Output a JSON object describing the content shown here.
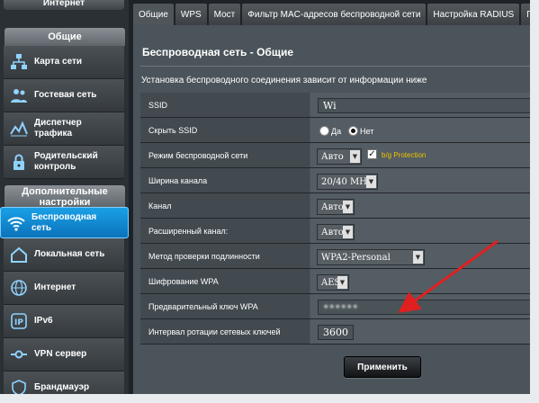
{
  "sidebar": {
    "top_label": "Интернет",
    "general_header": "Общие",
    "general_items": [
      {
        "label": "Карта сети",
        "icon": "network-map-icon"
      },
      {
        "label": "Гостевая сеть",
        "icon": "guest-network-icon"
      },
      {
        "label": "Диспетчер трафика",
        "icon": "traffic-manager-icon"
      },
      {
        "label": "Родительский контроль",
        "icon": "parental-control-icon"
      }
    ],
    "advanced_header": "Дополнительные настройки",
    "advanced_items": [
      {
        "label": "Беспроводная сеть",
        "icon": "wireless-icon",
        "active": true
      },
      {
        "label": "Локальная сеть",
        "icon": "lan-icon"
      },
      {
        "label": "Интернет",
        "icon": "internet-globe-icon"
      },
      {
        "label": "IPv6",
        "icon": "ipv6-icon"
      },
      {
        "label": "VPN сервер",
        "icon": "vpn-icon"
      },
      {
        "label": "Брандмауэр",
        "icon": "firewall-icon"
      }
    ]
  },
  "tabs": [
    "Общие",
    "WPS",
    "Мост",
    "Фильтр MAC-адресов беспроводной сети",
    "Настройка RADIUS",
    "Профе"
  ],
  "page": {
    "title": "Беспроводная сеть - Общие",
    "description": "Установка беспроводного соединения зависит от информации ниже"
  },
  "form": {
    "ssid_label": "SSID",
    "ssid_value": "Wi",
    "hide_ssid_label": "Скрыть SSID",
    "hide_yes": "Да",
    "hide_no": "Нет",
    "mode_label": "Режим беспроводной сети",
    "mode_value": "Авто",
    "bg_protection_label": "b/g Protection",
    "width_label": "Ширина канала",
    "width_value": "20/40 MHz",
    "channel_label": "Канал",
    "channel_value": "Авто",
    "ext_channel_label": "Расширенный канал:",
    "ext_channel_value": "Авто",
    "auth_label": "Метод проверки подлинности",
    "auth_value": "WPA2-Personal",
    "enc_label": "Шифрование WPA",
    "enc_value": "AES",
    "psk_label": "Предварительный ключ WPA",
    "psk_value": "••••••",
    "interval_label": "Интервал ротации сетевых ключей",
    "interval_value": "3600"
  },
  "apply_label": "Применить",
  "colors": {
    "active_item": "#0a8ad6",
    "annotation_arrow": "#e02020",
    "bg_protection": "#f2c200"
  }
}
